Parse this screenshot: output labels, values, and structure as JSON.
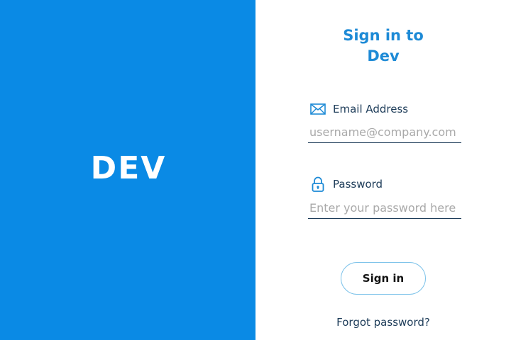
{
  "brand": {
    "logo_text": "DEV"
  },
  "login": {
    "title": "Sign in to Dev",
    "email": {
      "label": "Email Address",
      "placeholder": "username@company.com",
      "value": ""
    },
    "password": {
      "label": "Password",
      "placeholder": "Enter your password here",
      "value": ""
    },
    "signin_label": "Sign in",
    "forgot_label": "Forgot password?"
  },
  "icons": {
    "email": "envelope-icon",
    "password": "lock-icon"
  },
  "colors": {
    "brand_panel": "#0a8ae5",
    "title": "#1d8ad6",
    "label_text": "#1c3b58",
    "icon_accent": "#1d8ad6",
    "button_border": "#7ec3ea",
    "placeholder": "#a9a9a9"
  }
}
